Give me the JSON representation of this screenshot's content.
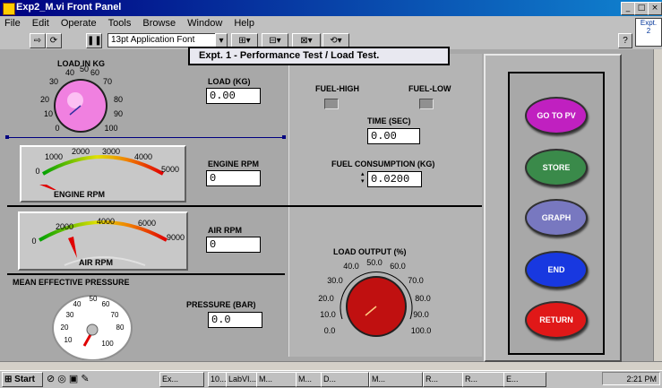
{
  "window": {
    "title": "Exp2_M.vi Front Panel"
  },
  "menu": [
    "File",
    "Edit",
    "Operate",
    "Tools",
    "Browse",
    "Window",
    "Help"
  ],
  "toolbar": {
    "font": "13pt Application Font"
  },
  "expt_box": {
    "line1": "Expt.",
    "line2": "2"
  },
  "banner": "Expt. 1 -  Performance Test / Load Test.",
  "load_kg": {
    "title": "LOAD IN KG",
    "ticks": [
      "0",
      "10",
      "20",
      "30",
      "40",
      "50",
      "60",
      "70",
      "80",
      "90",
      "100"
    ],
    "value_label": "LOAD (KG)",
    "value": "0.00",
    "knob_level": 0.0
  },
  "engine_rpm": {
    "gauge_caption": "ENGINE RPM",
    "ticks": [
      "0",
      "1000",
      "2000",
      "3000",
      "4000",
      "5000"
    ],
    "value_label": "ENGINE RPM",
    "value": "0"
  },
  "air_rpm": {
    "gauge_caption": "AIR RPM",
    "ticks": [
      "0",
      "2000",
      "4000",
      "6000",
      "9000"
    ],
    "value_label": "AIR RPM",
    "value": "0"
  },
  "mep": {
    "title": "MEAN EFFECTIVE PRESSURE",
    "ticks": [
      "10",
      "20",
      "30",
      "40",
      "50",
      "60",
      "70",
      "80",
      "100"
    ],
    "value_label": "PRESSURE (BAR)",
    "value": "0.0"
  },
  "fuel": {
    "high_label": "FUEL-HIGH",
    "low_label": "FUEL-LOW",
    "time_label": "TIME (SEC)",
    "time_value": "0.00",
    "consumption_label": "FUEL CONSUMPTION (KG)",
    "consumption_value": "0.0200"
  },
  "load_output": {
    "label": "LOAD OUTPUT (%)",
    "ticks": [
      "0.0",
      "10.0",
      "20.0",
      "30.0",
      "40.0",
      "50.0",
      "60.0",
      "70.0",
      "80.0",
      "90.0",
      "100.0"
    ]
  },
  "buttons": [
    {
      "label": "GO TO PV",
      "color": "#c020c0"
    },
    {
      "label": "STORE",
      "color": "#3a8a4a"
    },
    {
      "label": "GRAPH",
      "color": "#7878c0"
    },
    {
      "label": "END",
      "color": "#1838e0"
    },
    {
      "label": "RETURN",
      "color": "#e01818"
    }
  ],
  "taskbar": {
    "start": "Start",
    "items": [
      "Ex...",
      "10...",
      "LabVI...",
      "M...",
      "M...",
      "D...",
      "M...",
      "R...",
      "R...",
      "E..."
    ],
    "time": "2:21 PM"
  }
}
